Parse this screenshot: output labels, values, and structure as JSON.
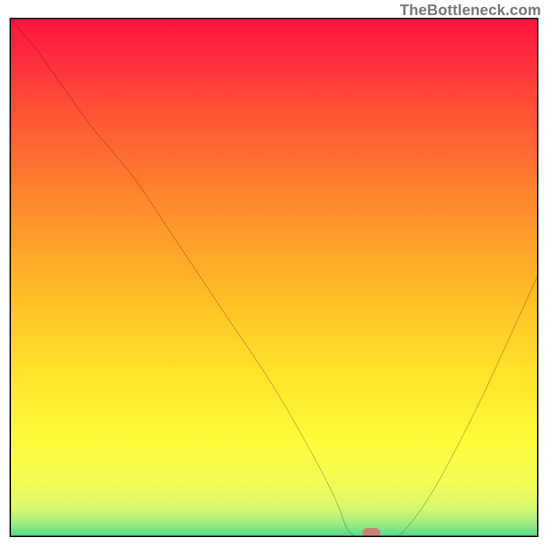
{
  "watermark": "TheBottleneck.com",
  "chart_data": {
    "type": "line",
    "title": "",
    "xlabel": "",
    "ylabel": "",
    "xlim": [
      0,
      100
    ],
    "ylim": [
      0,
      100
    ],
    "grid": false,
    "legend": false,
    "background_gradient_stops": [
      {
        "offset": 0.0,
        "color": "#ff153f"
      },
      {
        "offset": 0.07,
        "color": "#ff2b3e"
      },
      {
        "offset": 0.18,
        "color": "#ff5436"
      },
      {
        "offset": 0.3,
        "color": "#ff7a2f"
      },
      {
        "offset": 0.42,
        "color": "#ff9f2a"
      },
      {
        "offset": 0.55,
        "color": "#ffc426"
      },
      {
        "offset": 0.68,
        "color": "#ffe52b"
      },
      {
        "offset": 0.8,
        "color": "#fdfb3a"
      },
      {
        "offset": 0.88,
        "color": "#f3fd55"
      },
      {
        "offset": 0.93,
        "color": "#d7f86f"
      },
      {
        "offset": 0.955,
        "color": "#a7ee80"
      },
      {
        "offset": 0.975,
        "color": "#6de089"
      },
      {
        "offset": 0.99,
        "color": "#30d384"
      },
      {
        "offset": 1.0,
        "color": "#19cd7f"
      }
    ],
    "series": [
      {
        "name": "bottleneck-curve",
        "x": [
          0,
          5,
          10,
          15,
          20,
          24,
          30,
          40,
          50,
          58,
          62,
          64,
          67,
          70,
          74,
          80,
          88,
          95,
          100
        ],
        "y": [
          100,
          94,
          87,
          80,
          74,
          69,
          60,
          45,
          30,
          16,
          8,
          3,
          0.5,
          0.5,
          2,
          10,
          25,
          40,
          51
        ]
      }
    ],
    "marker": {
      "x": 68.5,
      "y": 0.5,
      "shape": "pill",
      "color": "#cb7f78"
    }
  }
}
